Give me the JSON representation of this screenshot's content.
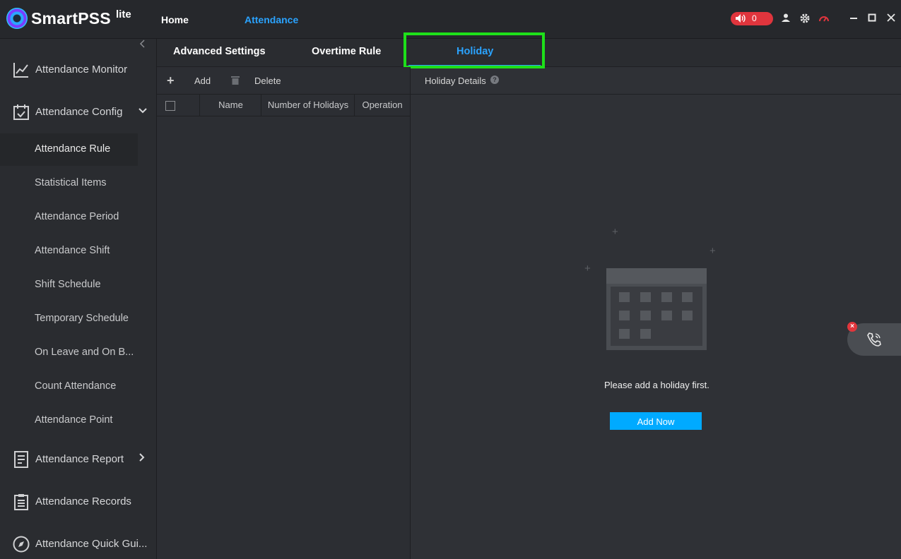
{
  "app": {
    "name": "SmartPSS",
    "name_sup": "lite",
    "nav": [
      "Home",
      "Attendance"
    ],
    "alarm_count": "0"
  },
  "sidebar": {
    "main": {
      "monitor": "Attendance Monitor",
      "config": "Attendance Config",
      "report": "Attendance Report",
      "records": "Attendance Records",
      "quick": "Attendance Quick Gui..."
    },
    "sub": [
      "Attendance Rule",
      "Statistical Items",
      "Attendance Period",
      "Attendance Shift",
      "Shift Schedule",
      "Temporary Schedule",
      "On Leave and On B...",
      "Count Attendance",
      "Attendance Point"
    ]
  },
  "tabs": [
    "Advanced Settings",
    "Overtime Rule",
    "Holiday"
  ],
  "toolbar": {
    "add": "Add",
    "delete": "Delete"
  },
  "table": {
    "columns": [
      "Name",
      "Number of Holidays",
      "Operation"
    ]
  },
  "details": {
    "title": "Holiday Details",
    "empty_message": "Please add a holiday first.",
    "add_now": "Add Now"
  },
  "colors": {
    "accent": "#2aa3ff",
    "button": "#00aaff",
    "highlight": "#1ee01a",
    "alarm": "#e0353d"
  }
}
